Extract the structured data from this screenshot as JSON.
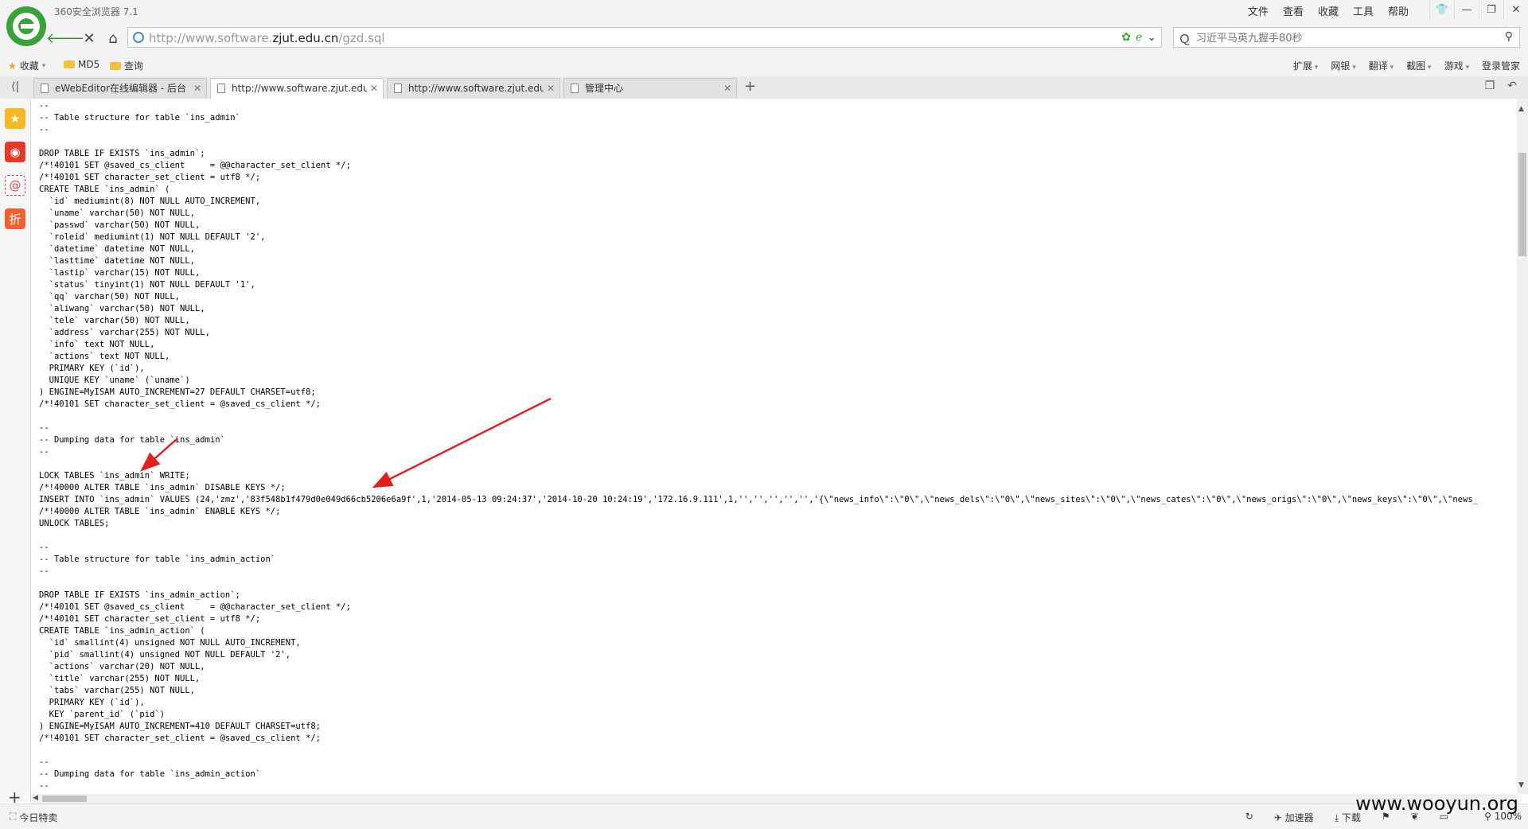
{
  "window": {
    "title": "360安全浏览器 7.1",
    "menu": [
      "文件",
      "查看",
      "收藏",
      "工具",
      "帮助"
    ],
    "controls": [
      "shirt-icon",
      "minimize-icon",
      "maximize-icon",
      "close-icon"
    ]
  },
  "nav": {
    "url_prefix": "http://www.software.",
    "url_domain": "zjut.edu.cn",
    "url_path": "/gzd.sql",
    "search_placeholder": "习近平马英九握手80秒"
  },
  "bookmarks": {
    "favorites": "收藏",
    "items": [
      "MD5",
      "查询"
    ],
    "tools": [
      "扩展",
      "网银",
      "翻译",
      "截图",
      "游戏"
    ],
    "login": "登录管家"
  },
  "tabs": [
    {
      "label": "eWebEditor在线编辑器 - 后台",
      "active": false
    },
    {
      "label": "http://www.software.zjut.edu",
      "active": true
    },
    {
      "label": "http://www.software.zjut.edu",
      "active": false
    },
    {
      "label": "管理中心",
      "active": false
    }
  ],
  "content": {
    "lines": [
      "--",
      "-- Table structure for table `ins_admin`",
      "--",
      "",
      "DROP TABLE IF EXISTS `ins_admin`;",
      "/*!40101 SET @saved_cs_client     = @@character_set_client */;",
      "/*!40101 SET character_set_client = utf8 */;",
      "CREATE TABLE `ins_admin` (",
      "  `id` mediumint(8) NOT NULL AUTO_INCREMENT,",
      "  `uname` varchar(50) NOT NULL,",
      "  `passwd` varchar(50) NOT NULL,",
      "  `roleid` mediumint(1) NOT NULL DEFAULT '2',",
      "  `datetime` datetime NOT NULL,",
      "  `lasttime` datetime NOT NULL,",
      "  `lastip` varchar(15) NOT NULL,",
      "  `status` tinyint(1) NOT NULL DEFAULT '1',",
      "  `qq` varchar(50) NOT NULL,",
      "  `aliwang` varchar(50) NOT NULL,",
      "  `tele` varchar(50) NOT NULL,",
      "  `address` varchar(255) NOT NULL,",
      "  `info` text NOT NULL,",
      "  `actions` text NOT NULL,",
      "  PRIMARY KEY (`id`),",
      "  UNIQUE KEY `uname` (`uname`)",
      ") ENGINE=MyISAM AUTO_INCREMENT=27 DEFAULT CHARSET=utf8;",
      "/*!40101 SET character_set_client = @saved_cs_client */;",
      "",
      "--",
      "-- Dumping data for table `ins_admin`",
      "--",
      "",
      "LOCK TABLES `ins_admin` WRITE;",
      "/*!40000 ALTER TABLE `ins_admin` DISABLE KEYS */;",
      "INSERT INTO `ins_admin` VALUES (24,'zmz','83f548b1f479d0e049d66cb5206e6a9f',1,'2014-05-13 09:24:37','2014-10-20 10:24:19','172.16.9.111',1,'','','','','','{\\\"news_info\\\":\\\"0\\\",\\\"news_dels\\\":\\\"0\\\",\\\"news_sites\\\":\\\"0\\\",\\\"news_cates\\\":\\\"0\\\",\\\"news_origs\\\":\\\"0\\\",\\\"news_keys\\\":\\\"0\\\",\\\"news_",
      "/*!40000 ALTER TABLE `ins_admin` ENABLE KEYS */;",
      "UNLOCK TABLES;",
      "",
      "--",
      "-- Table structure for table `ins_admin_action`",
      "--",
      "",
      "DROP TABLE IF EXISTS `ins_admin_action`;",
      "/*!40101 SET @saved_cs_client     = @@character_set_client */;",
      "/*!40101 SET character_set_client = utf8 */;",
      "CREATE TABLE `ins_admin_action` (",
      "  `id` smallint(4) unsigned NOT NULL AUTO_INCREMENT,",
      "  `pid` smallint(4) unsigned NOT NULL DEFAULT '2',",
      "  `actions` varchar(20) NOT NULL,",
      "  `title` varchar(255) NOT NULL,",
      "  `tabs` varchar(255) NOT NULL,",
      "  PRIMARY KEY (`id`),",
      "  KEY `parent_id` (`pid`)",
      ") ENGINE=MyISAM AUTO_INCREMENT=410 DEFAULT CHARSET=utf8;",
      "/*!40101 SET character_set_client = @saved_cs_client */;",
      "",
      "--",
      "-- Dumping data for table `ins_admin_action`",
      "--"
    ]
  },
  "statusbar": {
    "left": "今日特卖",
    "items": [
      "加速器",
      "下载"
    ],
    "zoom": "100%",
    "watermark": "www.wooyun.org"
  },
  "colors": {
    "accent": "#39a33a",
    "annotation_arrow": "#e02020"
  }
}
